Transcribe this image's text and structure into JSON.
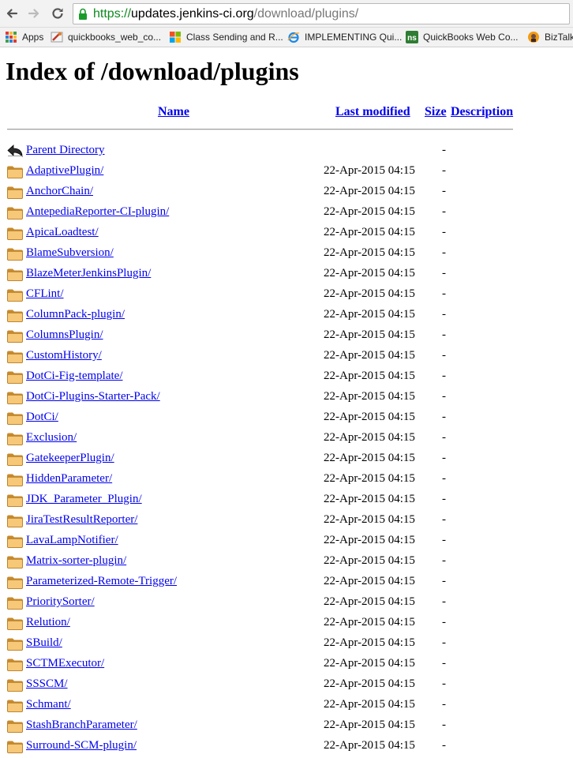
{
  "browser": {
    "url_scheme": "https://",
    "url_host": "updates.jenkins-ci.org",
    "url_path": "/download/plugins/",
    "bookmarks": [
      {
        "label": "Apps",
        "icon": "apps-grid-icon"
      },
      {
        "label": "quickbooks_web_co...",
        "icon": "bookmark-favicon"
      },
      {
        "label": "Class Sending and R...",
        "icon": "windows-logo-icon"
      },
      {
        "label": "IMPLEMENTING Qui...",
        "icon": "ie-logo-icon"
      },
      {
        "label": "QuickBooks Web Co...",
        "icon": "ns-logo-icon"
      },
      {
        "label": "BizTalk'",
        "icon": "biztalk-favicon"
      }
    ]
  },
  "page": {
    "title": "Index of /download/plugins",
    "columns": {
      "name": "Name",
      "last_modified": "Last modified",
      "size": "Size",
      "description": "Description"
    },
    "rows": [
      {
        "name": "Parent Directory",
        "modified": "",
        "size": "-",
        "icon": "back-arrow-icon"
      },
      {
        "name": "AdaptivePlugin/",
        "modified": "22-Apr-2015 04:15",
        "size": "-",
        "icon": "folder-icon"
      },
      {
        "name": "AnchorChain/",
        "modified": "22-Apr-2015 04:15",
        "size": "-",
        "icon": "folder-icon"
      },
      {
        "name": "AntepediaReporter-CI-plugin/",
        "modified": "22-Apr-2015 04:15",
        "size": "-",
        "icon": "folder-icon"
      },
      {
        "name": "ApicaLoadtest/",
        "modified": "22-Apr-2015 04:15",
        "size": "-",
        "icon": "folder-icon"
      },
      {
        "name": "BlameSubversion/",
        "modified": "22-Apr-2015 04:15",
        "size": "-",
        "icon": "folder-icon"
      },
      {
        "name": "BlazeMeterJenkinsPlugin/",
        "modified": "22-Apr-2015 04:15",
        "size": "-",
        "icon": "folder-icon"
      },
      {
        "name": "CFLint/",
        "modified": "22-Apr-2015 04:15",
        "size": "-",
        "icon": "folder-icon"
      },
      {
        "name": "ColumnPack-plugin/",
        "modified": "22-Apr-2015 04:15",
        "size": "-",
        "icon": "folder-icon"
      },
      {
        "name": "ColumnsPlugin/",
        "modified": "22-Apr-2015 04:15",
        "size": "-",
        "icon": "folder-icon"
      },
      {
        "name": "CustomHistory/",
        "modified": "22-Apr-2015 04:15",
        "size": "-",
        "icon": "folder-icon"
      },
      {
        "name": "DotCi-Fig-template/",
        "modified": "22-Apr-2015 04:15",
        "size": "-",
        "icon": "folder-icon"
      },
      {
        "name": "DotCi-Plugins-Starter-Pack/",
        "modified": "22-Apr-2015 04:15",
        "size": "-",
        "icon": "folder-icon"
      },
      {
        "name": "DotCi/",
        "modified": "22-Apr-2015 04:15",
        "size": "-",
        "icon": "folder-icon"
      },
      {
        "name": "Exclusion/",
        "modified": "22-Apr-2015 04:15",
        "size": "-",
        "icon": "folder-icon"
      },
      {
        "name": "GatekeeperPlugin/",
        "modified": "22-Apr-2015 04:15",
        "size": "-",
        "icon": "folder-icon"
      },
      {
        "name": "HiddenParameter/",
        "modified": "22-Apr-2015 04:15",
        "size": "-",
        "icon": "folder-icon"
      },
      {
        "name": "JDK_Parameter_Plugin/",
        "modified": "22-Apr-2015 04:15",
        "size": "-",
        "icon": "folder-icon"
      },
      {
        "name": "JiraTestResultReporter/",
        "modified": "22-Apr-2015 04:15",
        "size": "-",
        "icon": "folder-icon"
      },
      {
        "name": "LavaLampNotifier/",
        "modified": "22-Apr-2015 04:15",
        "size": "-",
        "icon": "folder-icon"
      },
      {
        "name": "Matrix-sorter-plugin/",
        "modified": "22-Apr-2015 04:15",
        "size": "-",
        "icon": "folder-icon"
      },
      {
        "name": "Parameterized-Remote-Trigger/",
        "modified": "22-Apr-2015 04:15",
        "size": "-",
        "icon": "folder-icon"
      },
      {
        "name": "PrioritySorter/",
        "modified": "22-Apr-2015 04:15",
        "size": "-",
        "icon": "folder-icon"
      },
      {
        "name": "Relution/",
        "modified": "22-Apr-2015 04:15",
        "size": "-",
        "icon": "folder-icon"
      },
      {
        "name": "SBuild/",
        "modified": "22-Apr-2015 04:15",
        "size": "-",
        "icon": "folder-icon"
      },
      {
        "name": "SCTMExecutor/",
        "modified": "22-Apr-2015 04:15",
        "size": "-",
        "icon": "folder-icon"
      },
      {
        "name": "SSSCM/",
        "modified": "22-Apr-2015 04:15",
        "size": "-",
        "icon": "folder-icon"
      },
      {
        "name": "Schmant/",
        "modified": "22-Apr-2015 04:15",
        "size": "-",
        "icon": "folder-icon"
      },
      {
        "name": "StashBranchParameter/",
        "modified": "22-Apr-2015 04:15",
        "size": "-",
        "icon": "folder-icon"
      },
      {
        "name": "Surround-SCM-plugin/",
        "modified": "22-Apr-2015 04:15",
        "size": "-",
        "icon": "folder-icon"
      }
    ]
  }
}
